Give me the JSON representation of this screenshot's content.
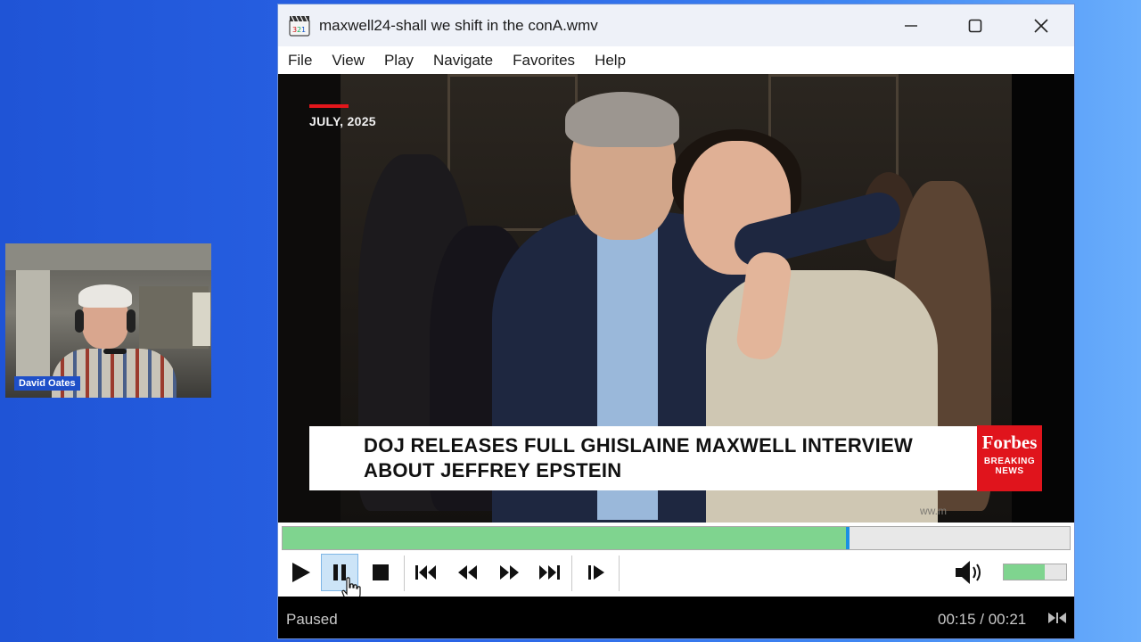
{
  "webcam": {
    "name_label": "David Oates"
  },
  "window": {
    "title": "maxwell24-shall we shift in the conA.wmv",
    "menu": [
      "File",
      "View",
      "Play",
      "Navigate",
      "Favorites",
      "Help"
    ]
  },
  "video": {
    "date_label": "JULY, 2025",
    "headline": "DOJ RELEASES FULL GHISLAINE MAXWELL INTERVIEW ABOUT JEFFREY EPSTEIN",
    "brand_name": "Forbes",
    "brand_sub_1": "BREAKING",
    "brand_sub_2": "NEWS",
    "watermark": "ww.m"
  },
  "controls": {
    "seek_progress_fraction": 0.716,
    "volume_fraction": 0.66,
    "buttons": [
      "play-icon",
      "pause-icon",
      "stop-icon",
      "skip-back-icon",
      "rewind-icon",
      "fast-forward-icon",
      "skip-forward-icon",
      "frame-step-icon",
      "speaker-icon"
    ],
    "accent_fill": "#7fd48f",
    "accent_thumb": "#1a8fe3"
  },
  "status": {
    "state": "Paused",
    "time": "00:15 / 00:21"
  }
}
